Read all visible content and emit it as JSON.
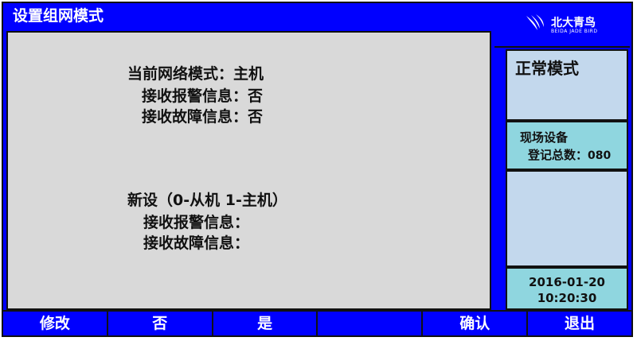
{
  "header": {
    "title": "设置组网模式"
  },
  "main": {
    "current_mode": "当前网络模式：主机",
    "current_alarm": "接收报警信息：否",
    "current_fault": "接收故障信息：否",
    "new_setting": "新设（0-从机  1-主机）",
    "new_alarm": "接收报警信息：",
    "new_fault": "接收故障信息："
  },
  "side": {
    "logo_cn": "北大青鸟",
    "logo_en": "BEIDA JADE BIRD",
    "mode": "正常模式",
    "device_title": "现场设备",
    "device_count_label": "登记总数：",
    "device_count": "080",
    "date": "2016-01-20",
    "time": "10:20:30"
  },
  "footer": {
    "buttons": [
      "修改",
      "否",
      "是",
      "",
      "确认",
      "退出"
    ]
  },
  "colors": {
    "blue": "#0000ff",
    "gray": "#d9d9d9",
    "light_blue": "#c3d8ed",
    "cyan": "#8fd6df"
  }
}
